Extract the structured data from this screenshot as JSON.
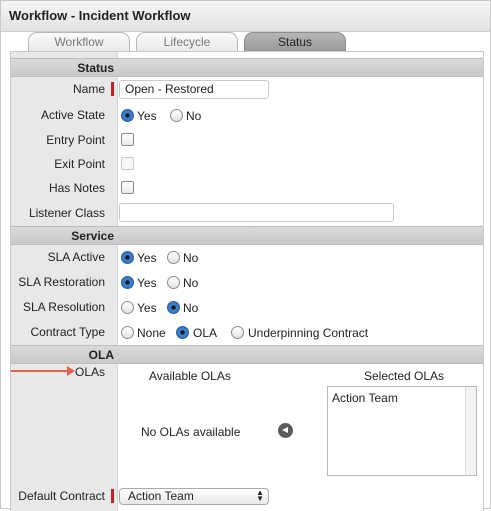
{
  "window": {
    "title": "Workflow - Incident Workflow"
  },
  "tabs": [
    {
      "label": "Workflow",
      "active": false
    },
    {
      "label": "Lifecycle",
      "active": false
    },
    {
      "label": "Status",
      "active": true
    }
  ],
  "status_section": {
    "header": "Status",
    "name_label": "Name",
    "name_value": "Open - Restored",
    "active_state_label": "Active State",
    "active_state_yes": "Yes",
    "active_state_no": "No",
    "active_state_selected": "Yes",
    "entry_point_label": "Entry Point",
    "entry_point_checked": false,
    "exit_point_label": "Exit Point",
    "exit_point_checked": false,
    "has_notes_label": "Has Notes",
    "has_notes_checked": false,
    "listener_class_label": "Listener Class",
    "listener_class_value": ""
  },
  "service_section": {
    "header": "Service",
    "sla_active_label": "SLA Active",
    "sla_restoration_label": "SLA Restoration",
    "sla_resolution_label": "SLA Resolution",
    "yes_label": "Yes",
    "no_label": "No",
    "sla_active_selected": "Yes",
    "sla_restoration_selected": "Yes",
    "sla_resolution_selected": "No",
    "contract_type_label": "Contract Type",
    "contract_options": [
      "None",
      "OLA",
      "Underpinning Contract"
    ],
    "contract_selected": "OLA"
  },
  "ola_section": {
    "header": "OLA",
    "olas_label": "OLAs",
    "available_header": "Available OLAs",
    "selected_header": "Selected OLAs",
    "available_empty_text": "No OLAs available",
    "selected_items": [
      "Action Team"
    ],
    "default_contract_label": "Default Contract",
    "default_contract_value": "Action Team"
  },
  "colors": {
    "required_marker": "#c21f1f",
    "annotation_arrow": "#e5604a",
    "radio_selected": "#3f86d6"
  }
}
